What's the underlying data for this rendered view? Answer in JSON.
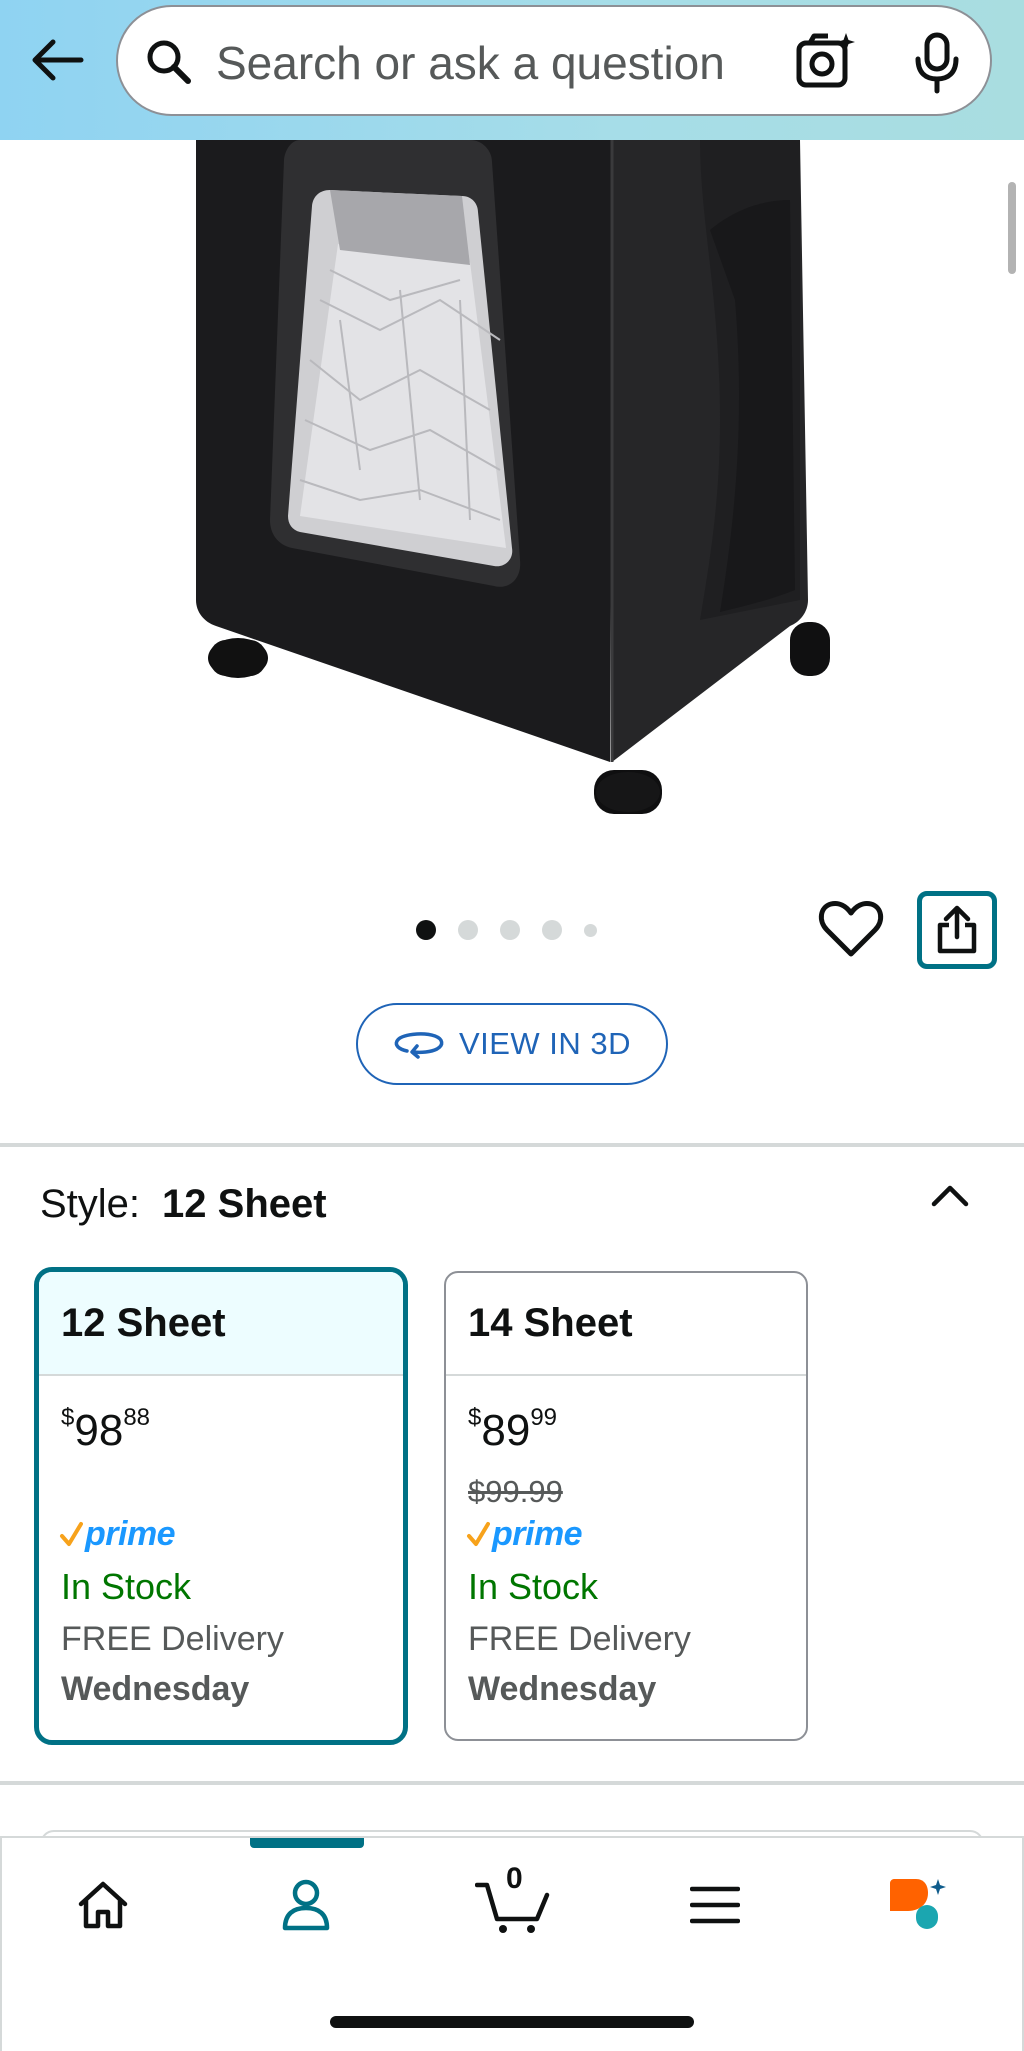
{
  "header": {
    "search_placeholder": "Search or ask a question"
  },
  "gallery": {
    "dot_count": 5,
    "active_index": 0,
    "view_3d_label": "VIEW IN 3D"
  },
  "style": {
    "label": "Style:",
    "selected_value": "12 Sheet",
    "options": [
      {
        "name": "12 Sheet",
        "price_symbol": "$",
        "price_whole": "98",
        "price_fraction": "88",
        "list_price": "",
        "prime": "prime",
        "stock": "In Stock",
        "delivery": "FREE Delivery",
        "delivery_day": "Wednesday",
        "selected": true
      },
      {
        "name": "14 Sheet",
        "price_symbol": "$",
        "price_whole": "89",
        "price_fraction": "99",
        "list_price": "$99.99",
        "prime": "prime",
        "stock": "In Stock",
        "delivery": "FREE Delivery",
        "delivery_day": "Wednesday",
        "selected": false
      }
    ]
  },
  "bottom_nav": {
    "items": [
      "home-icon",
      "account-icon",
      "cart-icon",
      "menu-icon",
      "rufus-icon"
    ],
    "active": "account-icon",
    "cart_count": "0"
  },
  "colors": {
    "accent_teal": "#007185",
    "link_blue": "#1f64b7",
    "in_stock_green": "#007600",
    "prime_blue": "#1a98ff",
    "header_gradient_start": "#8fd3f2"
  }
}
